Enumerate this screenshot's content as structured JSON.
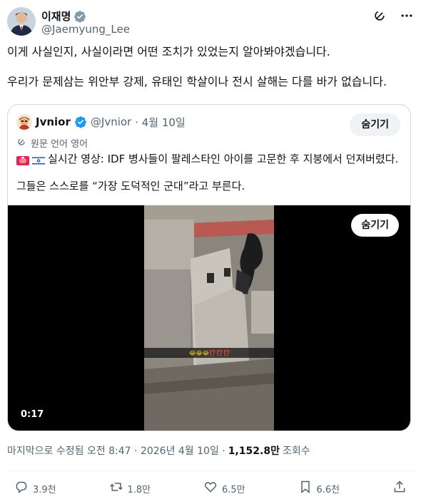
{
  "author": {
    "display_name": "이재명",
    "handle": "@Jaemyung_Lee"
  },
  "header_icons": [
    "grok-icon",
    "more-icon"
  ],
  "tweet": {
    "paragraph1": "이게 사실인지, 사실이라면 어떤 조치가 있었는지 알아봐야겠습니다.",
    "paragraph2": "우리가 문제삼는 위안부 강제, 유태인 학살이나 전시 살해는 다를 바가 없습니다."
  },
  "quote": {
    "display_name": "Jvnior",
    "handle": "@Jvnior",
    "date": "· 4월 10일",
    "hide_label": "숨기기",
    "translated_label": "원문 언어 영어",
    "line1": "실시간 영상: IDF 병사들이 팔레스타인 아이를 고문한 후 지붕에서 던져버렸다.",
    "line2": "그들은 스스로를 “가장 도덕적인 군대”라고 부른다.",
    "video": {
      "hide_label": "숨기기",
      "duration": "0:17",
      "caption": "😂😂😂⁉️⁉️⁉️"
    }
  },
  "meta": {
    "edited": "마지막으로 수정됨 오전 8:47 · 2026년 4월 10일 ·",
    "views": "1,152.8만",
    "views_label": "조회수"
  },
  "actions": {
    "replies": "3.9천",
    "reposts": "1.8만",
    "likes": "6.5만",
    "bookmarks": "6.6천"
  },
  "colors": {
    "text": "#0f1419",
    "secondary": "#536471",
    "verified": "#1d9bf0",
    "border": "#cfd9de"
  }
}
